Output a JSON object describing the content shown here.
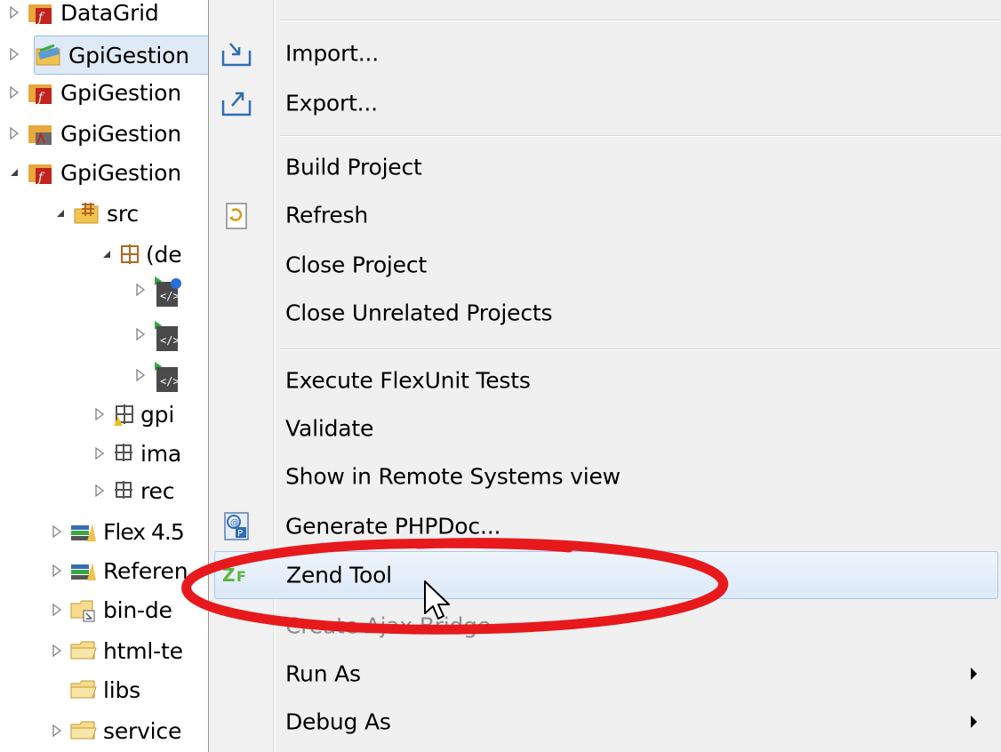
{
  "tree": {
    "items": [
      {
        "label": "DataGrid",
        "expanded": false
      },
      {
        "label": "GpiGestion",
        "expanded": false,
        "selected": true
      },
      {
        "label": "GpiGestion",
        "expanded": false
      },
      {
        "label": "GpiGestion",
        "expanded": false
      },
      {
        "label": "GpiGestion",
        "expanded": true
      },
      {
        "label": "src",
        "expanded": true
      },
      {
        "label": "(de",
        "expanded": true
      },
      {
        "label": "",
        "expanded": false
      },
      {
        "label": "",
        "expanded": false
      },
      {
        "label": "",
        "expanded": false
      },
      {
        "label": "gpi",
        "expanded": false
      },
      {
        "label": "ima",
        "expanded": false
      },
      {
        "label": "rec",
        "expanded": false
      },
      {
        "label": "Flex 4.5",
        "expanded": false
      },
      {
        "label": "Referen",
        "expanded": false
      },
      {
        "label": "bin-de",
        "expanded": false
      },
      {
        "label": "html-te",
        "expanded": false
      },
      {
        "label": "libs",
        "expanded": null
      },
      {
        "label": "service",
        "expanded": false
      }
    ]
  },
  "menu": {
    "items": [
      {
        "label": "Import...",
        "icon": "import-icon"
      },
      {
        "label": "Export...",
        "icon": "export-icon"
      },
      {
        "label": "Build Project"
      },
      {
        "label": "Refresh",
        "icon": "refresh-icon"
      },
      {
        "label": "Close Project"
      },
      {
        "label": "Close Unrelated Projects"
      },
      {
        "label": "Execute FlexUnit Tests"
      },
      {
        "label": "Validate"
      },
      {
        "label": "Show in Remote Systems view"
      },
      {
        "label": "Generate PHPDoc...",
        "icon": "phpdoc-icon"
      },
      {
        "label": "Zend Tool",
        "icon": "zend-icon",
        "highlighted": true
      },
      {
        "label": "Create Ajax Bridge",
        "disabled": true
      },
      {
        "label": "Run As",
        "submenu": true
      },
      {
        "label": "Debug As",
        "submenu": true
      }
    ]
  },
  "colors": {
    "annotation": "#e8191c",
    "highlight": "#dce9f8",
    "menu_bg": "#f0f0f0"
  }
}
